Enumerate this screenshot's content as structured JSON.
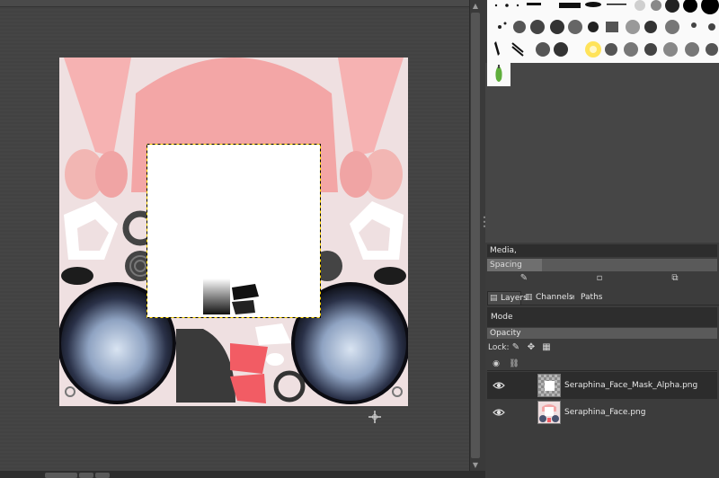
{
  "brushes": {
    "panel_label": "Brushes",
    "media_value": "Media,",
    "spacing_label": "Spacing",
    "spacing_fill_percent": 24
  },
  "dock_tabs": [
    {
      "label": "Layers",
      "icon": "layers-icon",
      "active": true
    },
    {
      "label": "Channels",
      "icon": "channels-icon",
      "active": false
    },
    {
      "label": "Paths",
      "icon": "paths-icon",
      "active": false
    }
  ],
  "layers_panel": {
    "mode_label": "Mode",
    "opacity_label": "Opacity",
    "lock_label": "Lock:"
  },
  "layers": [
    {
      "name": "Seraphina_Face_Mask_Alpha.png",
      "visible": true,
      "selected": true
    },
    {
      "name": "Seraphina_Face.png",
      "visible": true,
      "selected": false
    }
  ],
  "colors": {
    "canvas_bg": "#454545",
    "image_bg": "#f0dfe0",
    "texture_pink": "#f3a3a3",
    "selection_fill": "#ffffff",
    "red_patch": "#f25c64",
    "dark_patch": "#3a3a3a"
  },
  "icons": {
    "pointer": "move-crosshair-icon",
    "eye": "eye-icon",
    "edit_brush": "edit-brush-icon",
    "new_brush": "new-brush-icon",
    "duplicate_brush": "duplicate-brush-icon",
    "lock_pixels": "paintbrush-lock-icon",
    "lock_position": "move-lock-icon",
    "lock_alpha": "checker-lock-icon",
    "chain": "chain-icon"
  }
}
